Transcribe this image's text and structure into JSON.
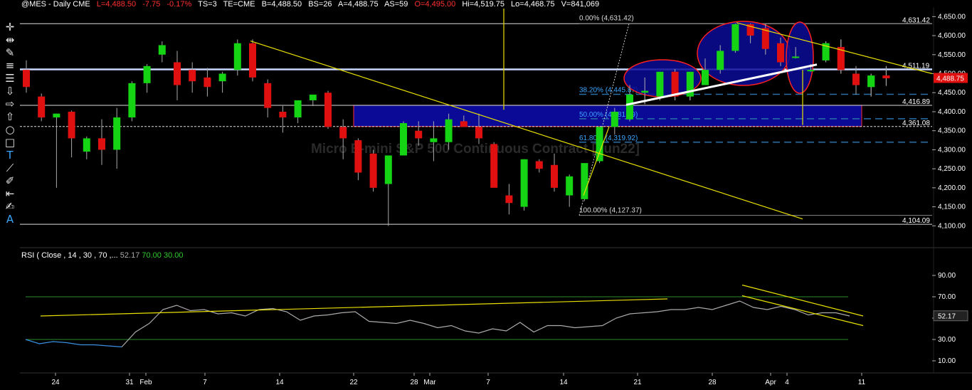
{
  "header": {
    "symbol": "@MES - Daily  CME",
    "last": "L=4,488.50",
    "change": "-7.75",
    "change_pct": "-0.17%",
    "ts": "TS=3",
    "te": "TE=CME",
    "bid": "B=4,488.50",
    "bid_size": "BS=26",
    "ask": "A=4,488.75",
    "ask_size": "AS=59",
    "open": "O=4,495.00",
    "high": "Hi=4,519.75",
    "low": "Lo=4,468.75",
    "volume": "V=841,069",
    "down_color": "#ff3030"
  },
  "toolbar": {
    "icons": [
      "crosshair-icon",
      "arrows-icon",
      "pencil-icon",
      "bars-icon",
      "lines-icon",
      "down-arrow-icon",
      "right-arrow-icon",
      "up-arrow-icon",
      "circle-icon",
      "rectangle-icon",
      "text-icon",
      "line-tool-icon",
      "pen-icon",
      "measure-icon",
      "brush-icon",
      "font-icon"
    ]
  },
  "watermark": "Micro E-mini S&P 500 Continuous Contract [Jun22]",
  "price_axis": {
    "ticks": [
      "4,650.00",
      "4,600.00",
      "4,550.00",
      "4,500.00",
      "4,450.00",
      "4,400.00",
      "4,350.00",
      "4,300.00",
      "4,250.00",
      "4,200.00",
      "4,150.00",
      "4,100.00"
    ],
    "tick_values": [
      4650,
      4600,
      4550,
      4500,
      4450,
      4400,
      4350,
      4300,
      4250,
      4200,
      4150,
      4100
    ],
    "last_price": "4,488.75",
    "level_labels": [
      "4,631.42",
      "4,511.19",
      "4,416.89",
      "4,361.08",
      "4,104.09"
    ],
    "level_values": [
      4631.42,
      4511.19,
      4416.89,
      4361.08,
      4104.09
    ]
  },
  "fib_labels": [
    "0.00% (4,631.42)",
    "38.20% (4,445.87)",
    "50.00% (4,381.39)",
    "61.80% (4,319.92)",
    "100.00% (4,127.37)"
  ],
  "fib_values": [
    4631.42,
    4445.87,
    4381.39,
    4319.92,
    4127.37
  ],
  "date_axis": [
    "24",
    "31",
    "Feb",
    "7",
    "14",
    "22",
    "28",
    "Mar",
    "7",
    "14",
    "21",
    "28",
    "Apr",
    "4",
    "11"
  ],
  "rsi": {
    "label": "RSI ( Close , 14 , 30 , 70 ,...",
    "value": "52.17",
    "overbought": "70.00",
    "oversold": "30.00",
    "ticks": [
      "90.00",
      "70.00",
      "50.00",
      "30.00",
      "10.00"
    ],
    "tick_values": [
      90,
      70,
      50,
      30,
      10
    ],
    "current": 52.17
  },
  "colors": {
    "up": "#14d414",
    "down": "#e01010",
    "trend": "#e8e000",
    "zone": "#0a0a96",
    "fib": "#3aa6ff"
  },
  "chart_data": {
    "type": "candlestick",
    "title": "@MES - Daily",
    "ylim": [
      4080,
      4660
    ],
    "candles": [
      [
        4510,
        4535,
        4450,
        4465
      ],
      [
        4440,
        4448,
        4375,
        4385
      ],
      [
        4385,
        4395,
        4200,
        4395
      ],
      [
        4400,
        4403,
        4280,
        4330
      ],
      [
        4295,
        4335,
        4275,
        4330
      ],
      [
        4330,
        4380,
        4260,
        4300
      ],
      [
        4300,
        4410,
        4250,
        4385
      ],
      [
        4385,
        4480,
        4375,
        4475
      ],
      [
        4475,
        4525,
        4450,
        4520
      ],
      [
        4550,
        4585,
        4530,
        4575
      ],
      [
        4530,
        4560,
        4430,
        4470
      ],
      [
        4510,
        4530,
        4450,
        4480
      ],
      [
        4490,
        4515,
        4440,
        4465
      ],
      [
        4480,
        4505,
        4450,
        4500
      ],
      [
        4510,
        4590,
        4495,
        4580
      ],
      [
        4580,
        4590,
        4480,
        4490
      ],
      [
        4475,
        4485,
        4385,
        4410
      ],
      [
        4400,
        4415,
        4345,
        4385
      ],
      [
        4385,
        4425,
        4370,
        4430
      ],
      [
        4430,
        4440,
        4415,
        4445
      ],
      [
        4450,
        4455,
        4355,
        4360
      ],
      [
        4360,
        4380,
        4275,
        4330
      ],
      [
        4325,
        4330,
        4220,
        4240
      ],
      [
        4290,
        4300,
        4190,
        4200
      ],
      [
        4210,
        4280,
        4100,
        4285
      ],
      [
        4285,
        4375,
        4285,
        4370
      ],
      [
        4350,
        4375,
        4310,
        4330
      ],
      [
        4320,
        4375,
        4270,
        4330
      ],
      [
        4320,
        4395,
        4300,
        4380
      ],
      [
        4375,
        4390,
        4360,
        4360
      ],
      [
        4360,
        4395,
        4315,
        4330
      ],
      [
        4315,
        4320,
        4205,
        4200
      ],
      [
        4180,
        4210,
        4130,
        4160
      ],
      [
        4150,
        4275,
        4140,
        4275
      ],
      [
        4270,
        4275,
        4240,
        4250
      ],
      [
        4260,
        4290,
        4190,
        4200
      ],
      [
        4180,
        4235,
        4150,
        4230
      ],
      [
        4170,
        4260,
        4165,
        4265
      ],
      [
        4270,
        4355,
        4265,
        4360
      ],
      [
        4360,
        4410,
        4340,
        4400
      ],
      [
        4380,
        4470,
        4375,
        4445
      ],
      [
        4450,
        4490,
        4420,
        4455
      ],
      [
        4440,
        4505,
        4430,
        4505
      ],
      [
        4505,
        4512,
        4430,
        4440
      ],
      [
        4440,
        4505,
        4430,
        4505
      ],
      [
        4470,
        4540,
        4470,
        4510
      ],
      [
        4510,
        4575,
        4500,
        4560
      ],
      [
        4560,
        4632,
        4555,
        4630
      ],
      [
        4630,
        4632,
        4580,
        4600
      ],
      [
        4620,
        4630,
        4550,
        4565
      ],
      [
        4580,
        4595,
        4520,
        4530
      ],
      [
        4545,
        4570,
        4540,
        4545
      ],
      [
        4510,
        4525,
        4505,
        4510
      ],
      [
        4535,
        4585,
        4530,
        4580
      ],
      [
        4570,
        4590,
        4500,
        4510
      ],
      [
        4500,
        4520,
        4445,
        4470
      ],
      [
        4465,
        4500,
        4440,
        4495
      ],
      [
        4495,
        4520,
        4468,
        4488
      ]
    ],
    "rsi": [
      30,
      26,
      28,
      27,
      25,
      25,
      24,
      23,
      37,
      45,
      58,
      62,
      57,
      58,
      54,
      55,
      52,
      58,
      59,
      56,
      48,
      52,
      53,
      55,
      56,
      47,
      46,
      45,
      48,
      45,
      41,
      43,
      38,
      36,
      40,
      38,
      46,
      37,
      43,
      43,
      41,
      42,
      43,
      50,
      54,
      55,
      56,
      58,
      58,
      60,
      58,
      62,
      66,
      60,
      58,
      61,
      58,
      53,
      55,
      55,
      52
    ],
    "rsi_ylim": [
      0,
      100
    ]
  }
}
